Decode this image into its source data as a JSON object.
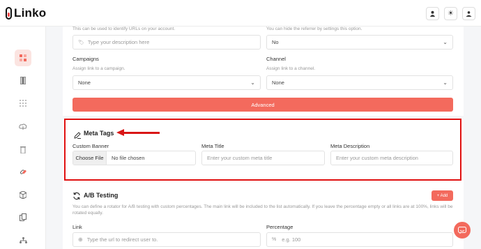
{
  "app": {
    "name": "Linko"
  },
  "header": {
    "icons": [
      "user-icon",
      "sun-icon",
      "profile-icon"
    ]
  },
  "sidebar": {
    "icons": [
      "dashboard-icon",
      "links-icon",
      "grid-icon",
      "cloud-icon",
      "trash-icon",
      "link-icon",
      "box-icon",
      "copy-icon",
      "network-icon"
    ]
  },
  "form": {
    "description_hint": "This can be used to identify URLs on your account.",
    "description_placeholder": "Type your description here",
    "referrer_hint": "You can hide the referrer by settings this option.",
    "referrer_value": "No",
    "campaigns_label": "Campaigns",
    "campaigns_hint": "Assign link to a campaign.",
    "campaigns_value": "None",
    "channel_label": "Channel",
    "channel_hint": "Assign link to a channel.",
    "channel_value": "None",
    "advanced_label": "Advanced"
  },
  "meta_tags": {
    "title": "Meta Tags",
    "custom_banner_label": "Custom Banner",
    "choose_file_label": "Choose File",
    "no_file_text": "No file chosen",
    "meta_title_label": "Meta Title",
    "meta_title_placeholder": "Enter your custom meta title",
    "meta_description_label": "Meta Description",
    "meta_description_placeholder": "Enter your custom meta description"
  },
  "ab_testing": {
    "title": "A/B Testing",
    "add_label": "+ Add",
    "description": "You can define a rotator for A/B testing with custom percentages. The main link will be included to the list automatically. If you leave the percentage empty or all links are at 100%, links will be rotated equally.",
    "link_label": "Link",
    "link_placeholder": "Type the url to redirect user to.",
    "percentage_label": "Percentage",
    "percentage_placeholder": "e.g. 100"
  },
  "colors": {
    "accent": "#f36a5d",
    "highlight": "#e01010"
  }
}
